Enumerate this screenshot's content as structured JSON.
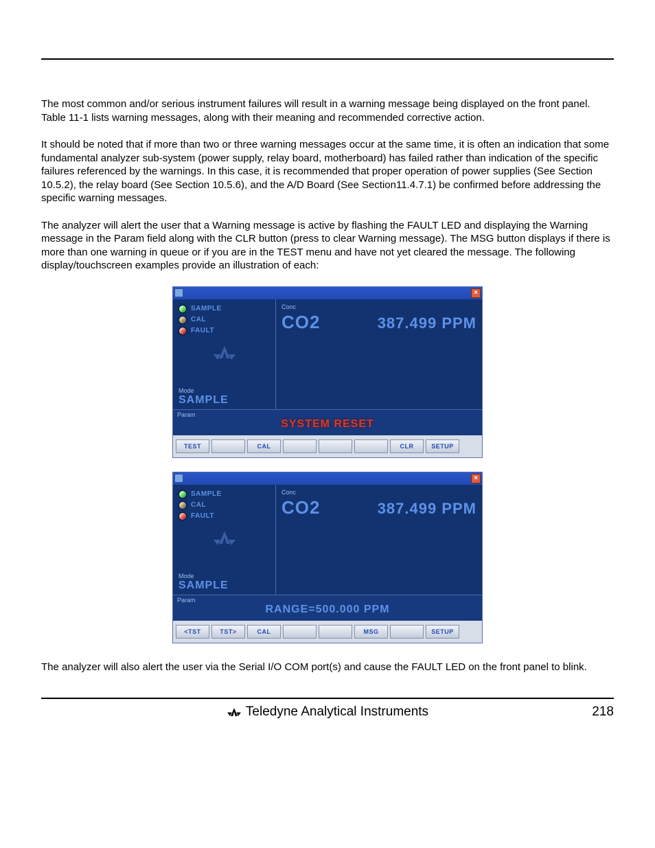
{
  "paragraphs": {
    "p1": "The most common and/or serious instrument failures will result in a warning message being displayed on the front panel.  Table 11-1 lists warning messages, along with their meaning and recommended corrective action.",
    "p2": "It should be noted that if more than two or three warning messages occur at the same time, it is often an indication that some fundamental analyzer sub-system (power supply, relay board, motherboard) has failed rather than indication of the specific failures referenced by the warnings.  In this case, it is recommended that proper operation of power supplies (See Section 10.5.2), the relay board (See Section 10.5.6), and the A/D Board (See Section11.4.7.1) be confirmed before addressing the specific warning messages.",
    "p3": "The analyzer will alert the user that a Warning message is active by flashing the FAULT LED and displaying the Warning message in the Param field along with the CLR button (press to clear Warning message). The MSG button displays if there is more than one warning in queue or if you are in the TEST menu and have not yet cleared the message. The following display/touchscreen examples provide an illustration of each:",
    "p4": "The analyzer will also alert the user via the Serial I/O COM port(s) and cause the FAULT LED on the front panel to blink."
  },
  "close_glyph": "×",
  "leds": {
    "sample": "SAMPLE",
    "cal": "CAL",
    "fault": "FAULT"
  },
  "mode_header": "Mode",
  "conc_header": "Conc",
  "param_header": "Param",
  "panel1": {
    "mode": "SAMPLE",
    "gas": "CO2",
    "value": "387.499 PPM",
    "param": "SYSTEM RESET",
    "buttons": {
      "b1": "TEST",
      "b2": "",
      "b3": "CAL",
      "b4": "",
      "b5": "",
      "b6": "",
      "b7": "CLR",
      "b8": "SETUP"
    }
  },
  "panel2": {
    "mode": "SAMPLE",
    "gas": "CO2",
    "value": "387.499 PPM",
    "param": "RANGE=500.000 PPM",
    "buttons": {
      "b1": "<TST",
      "b2": "TST>",
      "b3": "CAL",
      "b4": "",
      "b5": "",
      "b6": "MSG",
      "b7": "",
      "b8": "SETUP"
    }
  },
  "footer": {
    "text": "Teledyne Analytical Instruments",
    "page": "218"
  }
}
